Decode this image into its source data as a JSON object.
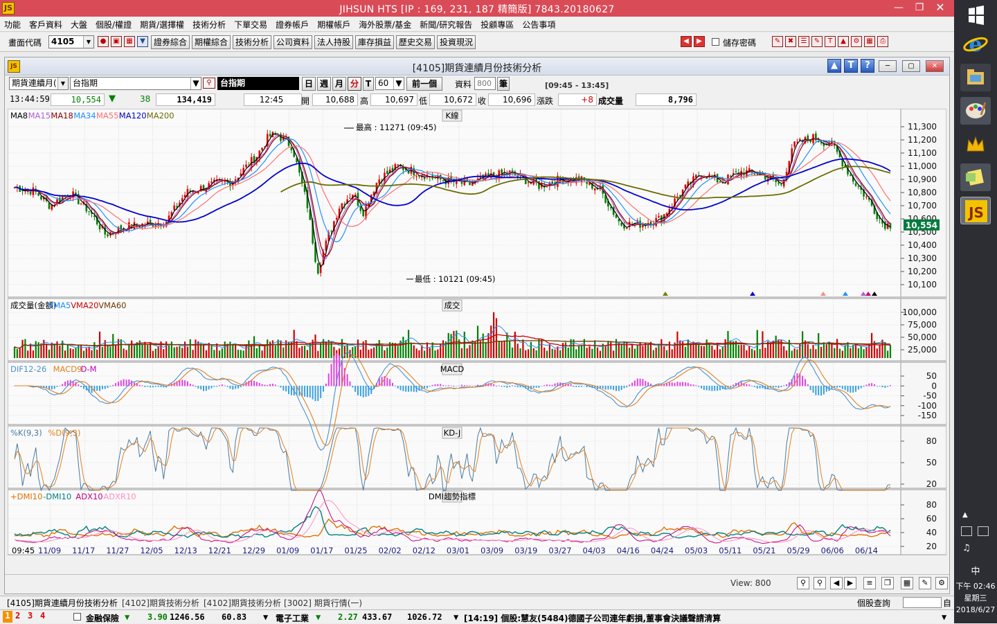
{
  "app": {
    "title": "JIHSUN HTS     [IP : 169, 231, 187 精簡版] 7843.20180627",
    "icon_text": "JS"
  },
  "menu": [
    "功能",
    "客戶資料",
    "大盤",
    "個股/權證",
    "期貨/選擇權",
    "技術分析",
    "下單交易",
    "證券帳戶",
    "期權帳戶",
    "海外股票/基金",
    "新聞/研究報告",
    "投顧專區",
    "公告事項"
  ],
  "toolbar": {
    "code_label": "畫面代碼",
    "code_value": "4105",
    "buttons": [
      "證券綜合",
      "期權綜合",
      "技術分析",
      "公司資料",
      "法人持股",
      "庫存損益",
      "歷史交易",
      "投資現況"
    ],
    "save_pw": "儲存密碼"
  },
  "window": {
    "title": "[4105]期貨連續月份技術分析"
  },
  "controls": {
    "product_type": "期貨連續月(",
    "product": "台指期",
    "product_name": "台指期",
    "periods": [
      "日",
      "週",
      "月",
      "分",
      "T"
    ],
    "active_period": "分",
    "minutes": "60",
    "prev": "前一個",
    "data_label": "資料",
    "data_count": "800",
    "data_unit": "筆",
    "session": "[09:45 - 13:45]"
  },
  "quote": {
    "time": "13:44:59",
    "last": "10,554",
    "change": "38",
    "volume_total": "134,419",
    "bar_time": "12:45",
    "open_label": "開",
    "open": "10,688",
    "high_label": "高",
    "high": "10,697",
    "low_label": "低",
    "low": "10,672",
    "close_label": "收",
    "close": "10,696",
    "chg_label": "漲跌",
    "chg": "+8",
    "vol_label": "成交量",
    "vol": "8,796"
  },
  "panels": {
    "k": {
      "title": "K線",
      "legend": [
        {
          "t": "MA8",
          "c": "#000000"
        },
        {
          "t": "MA15",
          "c": "#b05fd0"
        },
        {
          "t": "MA18",
          "c": "#8b0000"
        },
        {
          "t": "MA34",
          "c": "#1e90ff"
        },
        {
          "t": "MA55",
          "c": "#ff6f6f"
        },
        {
          "t": "MA120",
          "c": "#0000cd"
        },
        {
          "t": "MA200",
          "c": "#6b6b00"
        }
      ],
      "ticks": [
        "11,300",
        "11,200",
        "11,100",
        "11,000",
        "10,900",
        "10,800",
        "10,700",
        "10,600",
        "10,500",
        "10,400",
        "10,300",
        "10,200",
        "10,100"
      ],
      "high_note": "最高 : 11271 (09:45)",
      "low_note": "最低 : 10121 (09:45)",
      "last_tag": "10,554"
    },
    "vol": {
      "title": "成交",
      "legend": [
        {
          "t": "成交量(金額)",
          "c": "#000000"
        },
        {
          "t": "VMA5",
          "c": "#1e90ff"
        },
        {
          "t": "VMA20",
          "c": "#d00000"
        },
        {
          "t": "VMA60",
          "c": "#6b3a00"
        }
      ],
      "ticks": [
        "100,000",
        "75,000",
        "50,000",
        "25,000"
      ]
    },
    "macd": {
      "title": "MACD",
      "legend": [
        {
          "t": "DIF12-26",
          "c": "#4a90d0"
        },
        {
          "t": "MACD9",
          "c": "#e08020"
        },
        {
          "t": "D-M",
          "c": "#c000c0"
        }
      ],
      "ticks": [
        "50",
        "0",
        "-50",
        "-100",
        "-150"
      ]
    },
    "kd": {
      "title": "KD-J",
      "legend": [
        {
          "t": "%K(9,3)",
          "c": "#4a7aa0"
        },
        {
          "t": "%D(9,3)",
          "c": "#e08020"
        }
      ],
      "ticks": [
        "80",
        "50",
        "20"
      ]
    },
    "dmi": {
      "title": "DMI趨勢指標",
      "legend": [
        {
          "t": "+DMI10",
          "c": "#e07000"
        },
        {
          "t": "-DMI10",
          "c": "#008080"
        },
        {
          "t": "ADX10",
          "c": "#c00080"
        },
        {
          "t": "ADXR10",
          "c": "#ff90c0"
        }
      ],
      "ticks": [
        "80",
        "60",
        "40",
        "20"
      ]
    }
  },
  "xaxis": [
    "09:45",
    "11/09",
    "11/17",
    "11/27",
    "12/05",
    "12/13",
    "12/21",
    "12/29",
    "01/09",
    "01/17",
    "01/25",
    "02/02",
    "02/12",
    "03/01",
    "03/09",
    "03/19",
    "03/27",
    "04/03",
    "04/16",
    "04/24",
    "05/03",
    "05/11",
    "05/21",
    "05/29",
    "06/06",
    "06/14"
  ],
  "view": {
    "label": "View:",
    "value": "800"
  },
  "tabs": [
    "[4105]期貨連續月份技術分析",
    "[4102]期貨技術分析",
    "[4102]期貨技術分析",
    "[3002] 期貨行情(一)"
  ],
  "stock_query": {
    "label": "個股查詢",
    "suffix": "自"
  },
  "ticker": {
    "nums": [
      "1",
      "2",
      "3",
      "4"
    ],
    "a_name": "金融保險",
    "a_chg": "3.90",
    "a_val": "1246.56",
    "a_v2": "60.83",
    "b_name": "電子工業",
    "b_chg": "2.27",
    "b_val": "433.67",
    "b_v2": "1026.72",
    "news": "[14:19] 個股:慧友(5484)德國子公司連年虧損,董事會決議聲請清算"
  },
  "clock": {
    "time": "下午 02:46",
    "day": "星期三",
    "date": "2018/6/27",
    "ime": "中"
  }
}
